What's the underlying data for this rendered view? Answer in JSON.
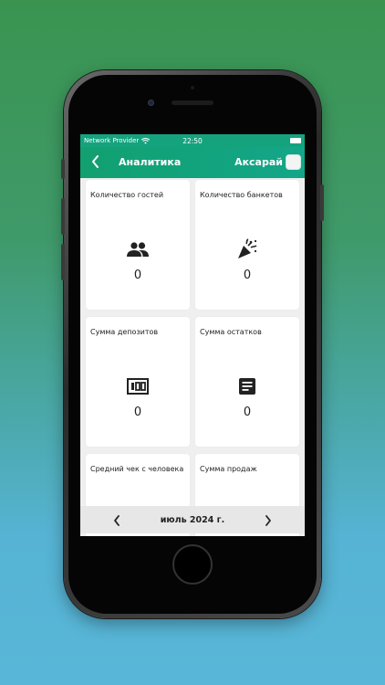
{
  "status": {
    "carrier": "Network Provider",
    "time": "22:50",
    "wifi_icon": "wifi-icon",
    "battery_icon": "battery-icon"
  },
  "header": {
    "back_icon": "chevron-left-icon",
    "title": "Аналитика",
    "venue": "Аксарай"
  },
  "cards": [
    {
      "label": "Количество гостей",
      "value": "0",
      "icon": "people-icon"
    },
    {
      "label": "Количество банкетов",
      "value": "0",
      "icon": "party-popper-icon"
    },
    {
      "label": "Сумма депозитов",
      "value": "0",
      "icon": "banknote-icon"
    },
    {
      "label": "Сумма остатков",
      "value": "0",
      "icon": "document-icon"
    },
    {
      "label": "Средний чек с человека",
      "value": "",
      "icon": ""
    },
    {
      "label": "Сумма продаж",
      "value": "",
      "icon": ""
    }
  ],
  "footer": {
    "prev_icon": "chevron-left-icon",
    "month": "июль 2024 г.",
    "next_icon": "chevron-right-icon"
  },
  "colors": {
    "accent": "#13a37e",
    "background_top": "#3a9450",
    "background_bottom": "#58b6d8"
  }
}
